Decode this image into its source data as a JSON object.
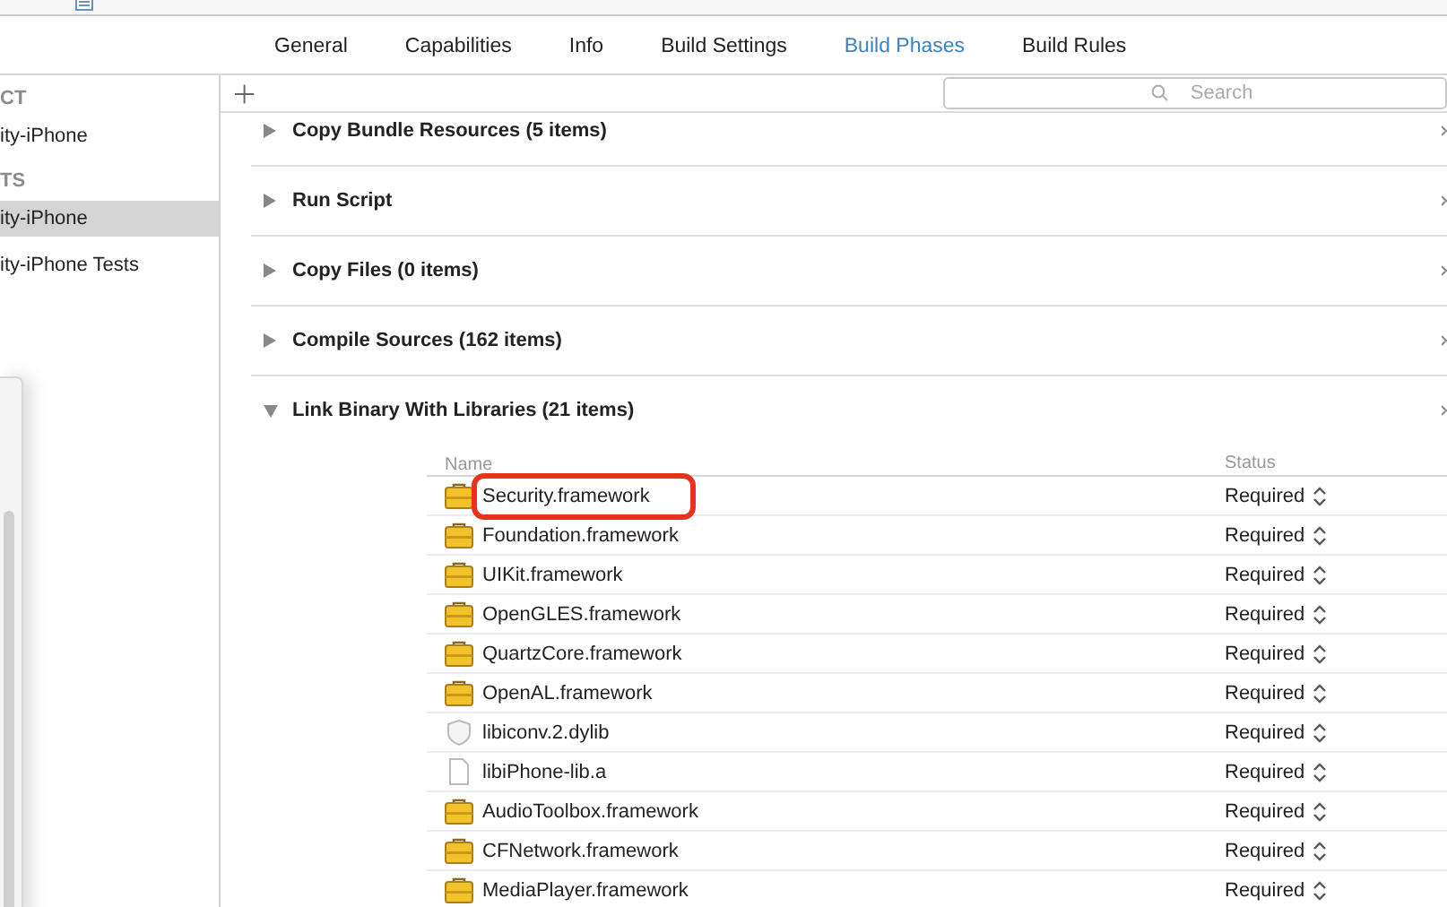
{
  "tabs": [
    {
      "label": "General",
      "selected": false
    },
    {
      "label": "Capabilities",
      "selected": false
    },
    {
      "label": "Info",
      "selected": false
    },
    {
      "label": "Build Settings",
      "selected": false
    },
    {
      "label": "Build Phases",
      "selected": true
    },
    {
      "label": "Build Rules",
      "selected": false
    }
  ],
  "sidebar": {
    "sections": [
      {
        "heading": "CT",
        "items": [
          {
            "label": "ity-iPhone",
            "selected": false
          }
        ]
      },
      {
        "heading": "TS",
        "items": [
          {
            "label": "ity-iPhone",
            "selected": true
          },
          {
            "label": "ity-iPhone Tests",
            "selected": false
          }
        ]
      }
    ]
  },
  "search": {
    "placeholder": "Search"
  },
  "phases": [
    {
      "title": "Copy Bundle Resources (5 items)",
      "expanded": false
    },
    {
      "title": "Run Script",
      "expanded": false
    },
    {
      "title": "Copy Files (0 items)",
      "expanded": false
    },
    {
      "title": "Compile Sources (162 items)",
      "expanded": false
    },
    {
      "title": "Link Binary With Libraries (21 items)",
      "expanded": true,
      "columns": [
        "Name",
        "Status"
      ],
      "rows": [
        {
          "name": "Security.framework",
          "kind": "framework",
          "status": "Required",
          "highlighted": true
        },
        {
          "name": "Foundation.framework",
          "kind": "framework",
          "status": "Required",
          "highlighted": false
        },
        {
          "name": "UIKit.framework",
          "kind": "framework",
          "status": "Required",
          "highlighted": false
        },
        {
          "name": "OpenGLES.framework",
          "kind": "framework",
          "status": "Required",
          "highlighted": false
        },
        {
          "name": "QuartzCore.framework",
          "kind": "framework",
          "status": "Required",
          "highlighted": false
        },
        {
          "name": "OpenAL.framework",
          "kind": "framework",
          "status": "Required",
          "highlighted": false
        },
        {
          "name": "libiconv.2.dylib",
          "kind": "dylib",
          "status": "Required",
          "highlighted": false
        },
        {
          "name": "libiPhone-lib.a",
          "kind": "file",
          "status": "Required",
          "highlighted": false
        },
        {
          "name": "AudioToolbox.framework",
          "kind": "framework",
          "status": "Required",
          "highlighted": false
        },
        {
          "name": "CFNetwork.framework",
          "kind": "framework",
          "status": "Required",
          "highlighted": false
        },
        {
          "name": "MediaPlayer.framework",
          "kind": "framework",
          "status": "Required",
          "highlighted": false
        }
      ]
    }
  ]
}
